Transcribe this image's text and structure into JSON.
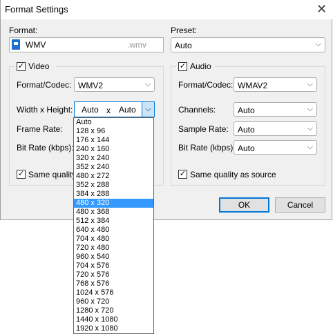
{
  "window": {
    "title": "Format Settings"
  },
  "format": {
    "label": "Format:",
    "value": "WMV",
    "extension": ".wmv",
    "icon": "file-icon"
  },
  "preset": {
    "label": "Preset:",
    "value": "Auto"
  },
  "video": {
    "group_label": "Video",
    "codec_label": "Format/Codec:",
    "codec_value": "WMV2",
    "size_label": "Width x Height:",
    "width_value": "Auto",
    "separator": "x",
    "height_value": "Auto",
    "framerate_label": "Frame Rate:",
    "bitrate_label": "Bit Rate (kbps):",
    "same_quality_label": "Same quality a"
  },
  "audio": {
    "group_label": "Audio",
    "codec_label": "Format/Codec:",
    "codec_value": "WMAV2",
    "channels_label": "Channels:",
    "channels_value": "Auto",
    "samplerate_label": "Sample Rate:",
    "samplerate_value": "Auto",
    "bitrate_label": "Bit Rate (kbps):",
    "bitrate_value": "Auto",
    "same_quality_label": "Same quality as source"
  },
  "buttons": {
    "ok": "OK",
    "cancel": "Cancel"
  },
  "resolution_dropdown": {
    "selected": "480 x 320",
    "options": [
      "Auto",
      "128 x 96",
      "176 x 144",
      "240 x 160",
      "320 x 240",
      "352 x 240",
      "480 x 272",
      "352 x 288",
      "384 x 288",
      "480 x 320",
      "480 x 368",
      "512 x 384",
      "640 x 480",
      "704 x 480",
      "720 x 480",
      "960 x 540",
      "704 x 576",
      "720 x 576",
      "768 x 576",
      "1024 x 576",
      "960 x 720",
      "1280 x 720",
      "1440 x 1080",
      "1920 x 1080"
    ]
  },
  "colors": {
    "accent": "#0078d7",
    "selection": "#3399ff",
    "dialog_bg": "#f0f0f0"
  }
}
